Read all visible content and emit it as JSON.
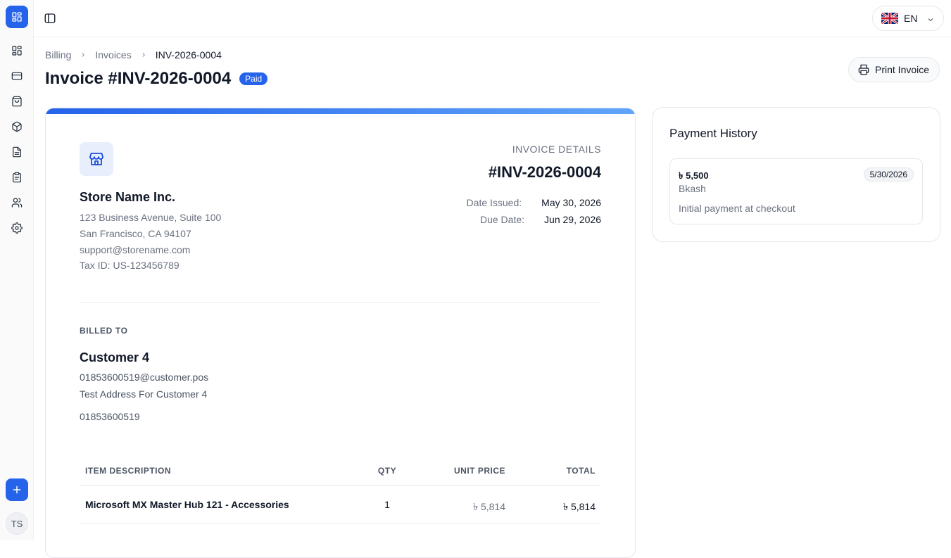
{
  "header": {
    "breadcrumb": [
      "Billing",
      "Invoices",
      "INV-2026-0004"
    ],
    "title": "Invoice #INV-2026-0004",
    "status_badge": "Paid",
    "print_label": "Print Invoice"
  },
  "language": {
    "code": "EN"
  },
  "sidebar": {
    "avatar_initials": "TS",
    "items": [
      {
        "icon": "dashboard-icon"
      },
      {
        "icon": "credit-card-icon"
      },
      {
        "icon": "shopping-bag-icon"
      },
      {
        "icon": "package-icon"
      },
      {
        "icon": "file-text-icon"
      },
      {
        "icon": "clipboard-icon"
      },
      {
        "icon": "users-icon"
      },
      {
        "icon": "settings-icon"
      }
    ]
  },
  "store": {
    "name": "Store Name Inc.",
    "address1": "123 Business Avenue, Suite 100",
    "address2": "San Francisco, CA 94107",
    "email": "support@storename.com",
    "tax_id": "Tax ID: US-123456789"
  },
  "invoice_details": {
    "label": "INVOICE DETAILS",
    "number": "#INV-2026-0004",
    "date_issued_label": "Date Issued:",
    "date_issued": "May 30, 2026",
    "due_date_label": "Due Date:",
    "due_date": "Jun 29, 2026"
  },
  "billed_to": {
    "label": "BILLED TO",
    "name": "Customer 4",
    "email": "01853600519@customer.pos",
    "address": "Test Address For Customer 4",
    "phone": "01853600519"
  },
  "items_table": {
    "headers": [
      "ITEM DESCRIPTION",
      "QTY",
      "UNIT PRICE",
      "TOTAL"
    ],
    "rows": [
      {
        "description": "Microsoft MX Master Hub 121 - Accessories",
        "qty": "1",
        "unit_price": "৳ 5,814",
        "total": "৳ 5,814"
      }
    ]
  },
  "payment_history": {
    "title": "Payment History",
    "payments": [
      {
        "amount": "৳ 5,500",
        "date": "5/30/2026",
        "method": "Bkash",
        "note": "Initial payment at checkout"
      }
    ]
  },
  "colors": {
    "accent": "#2563eb",
    "badge_bg": "#2563eb"
  }
}
